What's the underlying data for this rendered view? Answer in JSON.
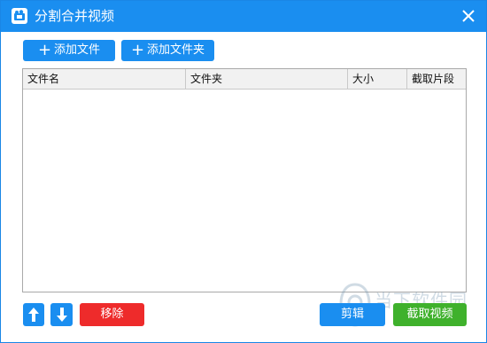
{
  "window": {
    "title": "分割合并视频",
    "title_bar_color": "#1a8ef0"
  },
  "icons": {
    "app": "video-app-icon",
    "close": "close-icon",
    "add": "plus-icon",
    "up": "arrow-up-icon",
    "down": "arrow-down-icon"
  },
  "toolbar": {
    "add_file_label": "添加文件",
    "add_folder_label": "添加文件夹"
  },
  "table": {
    "columns": [
      "文件名",
      "文件夹",
      "大小",
      "截取片段"
    ],
    "rows": []
  },
  "footer": {
    "remove_label": "移除",
    "cut_label": "剪辑",
    "capture_label": "截取视频"
  },
  "colors": {
    "primary": "#1a8ef0",
    "danger": "#ee2b2b",
    "success": "#3fb12c"
  },
  "watermark": {
    "text": "当下软件园"
  }
}
